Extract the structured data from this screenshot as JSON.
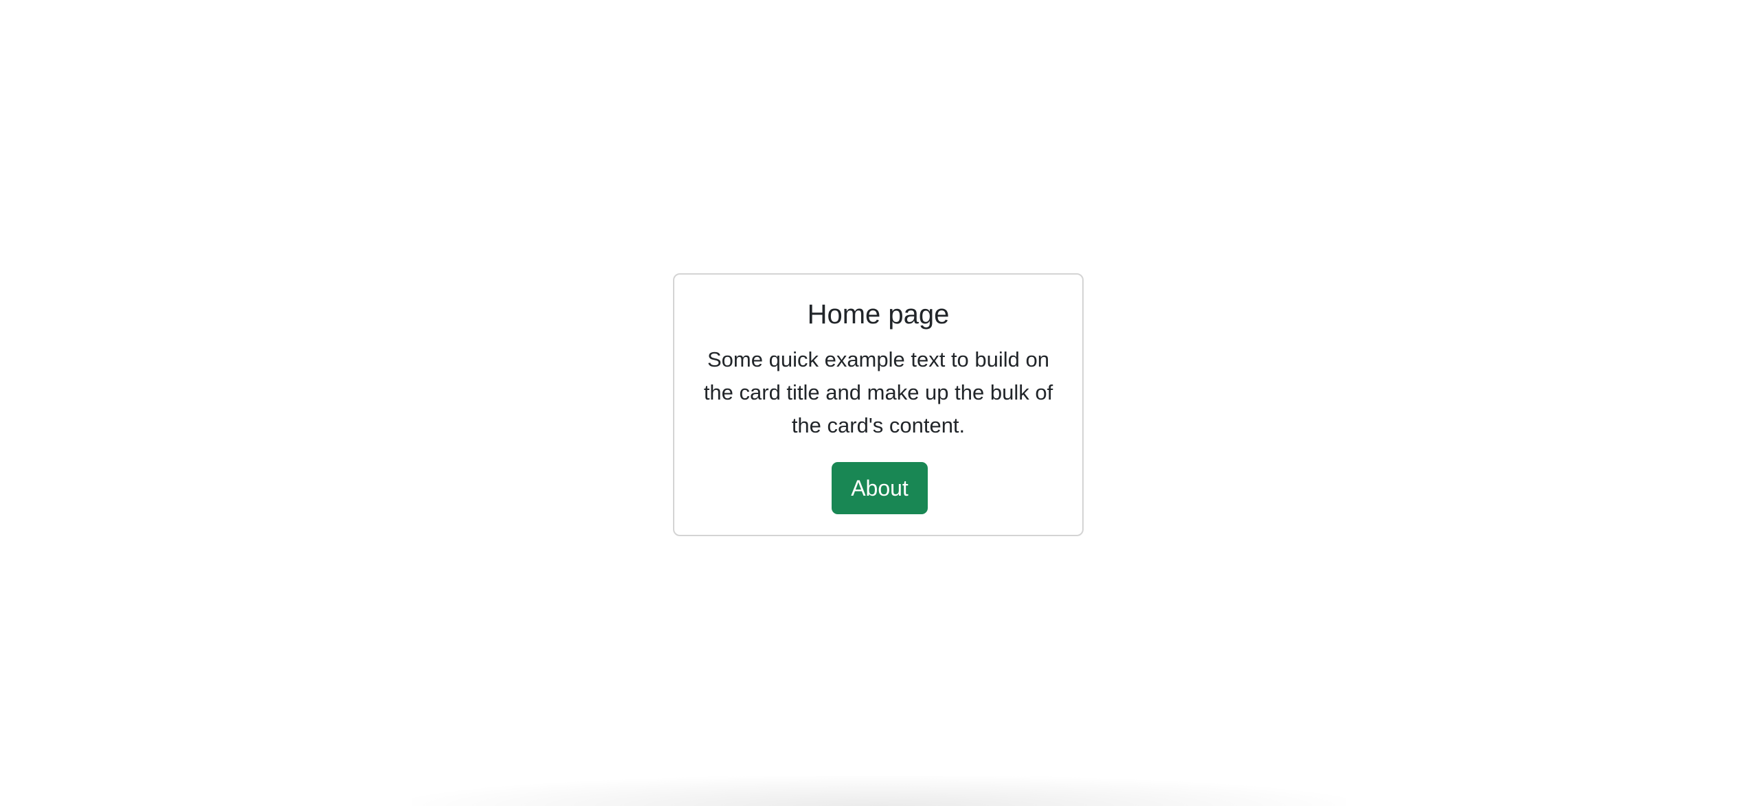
{
  "card": {
    "title": "Home page",
    "text": "Some quick example text to build on the card title and make up the bulk of the card's content.",
    "button_label": "About"
  },
  "colors": {
    "button_background": "#198754",
    "button_text": "#ffffff",
    "card_border": "#d4d4d4",
    "text": "#212529",
    "page_background": "#ffffff"
  }
}
